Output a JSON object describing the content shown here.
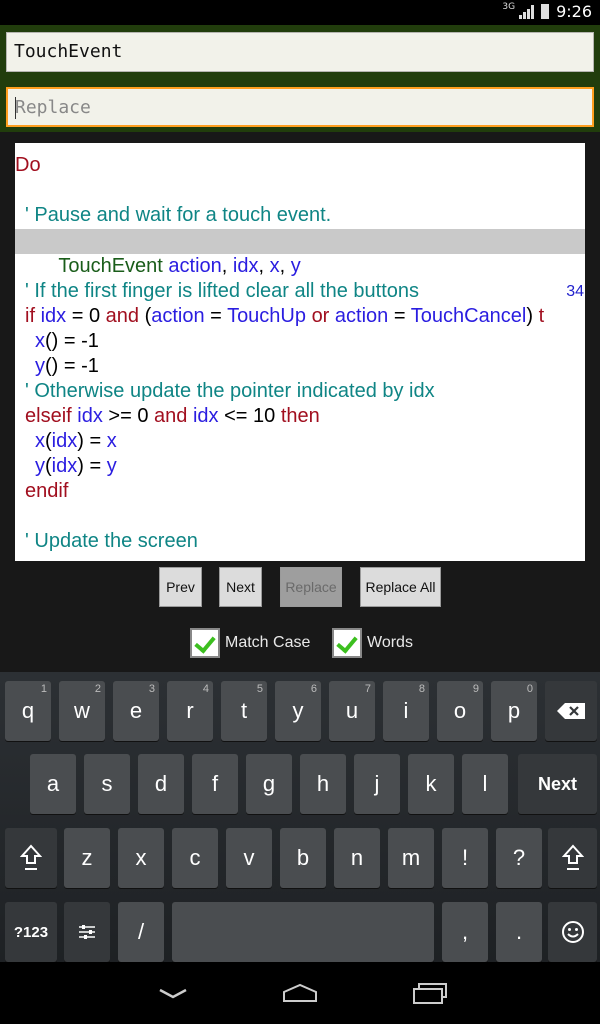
{
  "status_bar": {
    "network": "3G",
    "time": "9:26"
  },
  "search": {
    "find_value": "TouchEvent",
    "replace_placeholder": "Replace"
  },
  "editor": {
    "lines": [
      {
        "text": "Do"
      },
      {
        "text": ""
      },
      {
        "text": "' Pause and wait for a touch event."
      },
      {
        "text": "TouchEvent action, idx, x, y",
        "line_number": "34",
        "highlighted": true
      },
      {
        "text": ""
      },
      {
        "text": "' If the first finger is lifted clear all the buttons"
      },
      {
        "text": "if idx = 0 and (action = TouchUp or action = TouchCancel) t"
      },
      {
        "text": "x() = -1"
      },
      {
        "text": "y() = -1"
      },
      {
        "text": "' Otherwise update the pointer indicated by idx"
      },
      {
        "text": "elseif idx >= 0 and idx <= 10 then"
      },
      {
        "text": "x(idx) = x"
      },
      {
        "text": "y(idx) = y"
      },
      {
        "text": "endif"
      },
      {
        "text": ""
      },
      {
        "text": "' Update the screen"
      }
    ],
    "line_number": "34"
  },
  "buttons": {
    "prev": "Prev",
    "next": "Next",
    "replace": "Replace",
    "replace_all": "Replace All"
  },
  "options": {
    "match_case": "Match Case",
    "words": "Words"
  },
  "keyboard": {
    "row1": [
      "q",
      "w",
      "e",
      "r",
      "t",
      "y",
      "u",
      "i",
      "o",
      "p"
    ],
    "row1_hints": [
      "1",
      "2",
      "3",
      "4",
      "5",
      "6",
      "7",
      "8",
      "9",
      "0"
    ],
    "row2": [
      "a",
      "s",
      "d",
      "f",
      "g",
      "h",
      "j",
      "k",
      "l"
    ],
    "next_label": "Next",
    "row3": [
      "z",
      "x",
      "c",
      "v",
      "b",
      "n",
      "m",
      "!",
      "?"
    ],
    "sym_label": "?123",
    "slash": "/",
    "comma": ",",
    "period": "."
  },
  "icons": [
    "signal-icon",
    "battery-icon",
    "backspace-icon",
    "shift-icon",
    "settings-icon",
    "emoji-icon",
    "back-icon",
    "home-icon",
    "recents-icon"
  ],
  "colors": {
    "keyword": "#a10f1f",
    "comment": "#0f8585",
    "identifier": "#2a1de0",
    "highlight": "#c9c9c9",
    "search_bg": "#213d0c",
    "focus_border": "#ff9f1f"
  }
}
